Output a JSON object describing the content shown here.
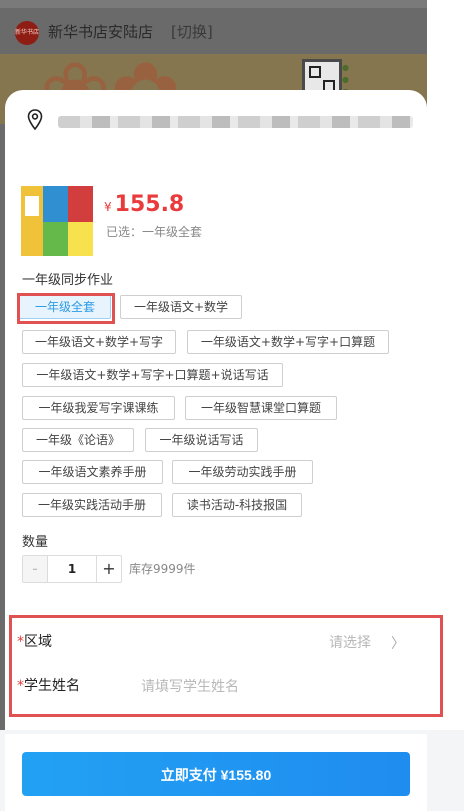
{
  "store": {
    "logo_text": "新华书店",
    "name": "新华书店安陆店",
    "switch_label": "[切换]"
  },
  "product": {
    "currency": "¥",
    "price": "155.8",
    "selected_text": "已选：一年级全套"
  },
  "spec_group": {
    "title": "一年级同步作业",
    "options": [
      "一年级全套",
      "一年级语文+数学",
      "一年级语文+数学+写字",
      "一年级语文+数学+写字+口算题",
      "一年级语文+数学+写字+口算题+说话写话",
      "一年级我爱写字课课练",
      "一年级智慧课堂口算题",
      "一年级《论语》",
      "一年级说话写话",
      "一年级语文素养手册",
      "一年级劳动实践手册",
      "一年级实践活动手册",
      "读书活动-科技报国"
    ],
    "selected": "一年级全套"
  },
  "quantity": {
    "label": "数量",
    "minus": "-",
    "value": "1",
    "plus": "+",
    "stock_text": "库存9999件"
  },
  "form": {
    "required_mark": "*",
    "region_label": "区域",
    "region_placeholder": "请选择",
    "student_label": "学生姓名",
    "student_placeholder": "请填写学生姓名"
  },
  "pay_button": "立即支付 ¥155.80",
  "colors": {
    "accent": "#2c9be6",
    "price": "#e93b3b",
    "highlight": "#e05151"
  }
}
